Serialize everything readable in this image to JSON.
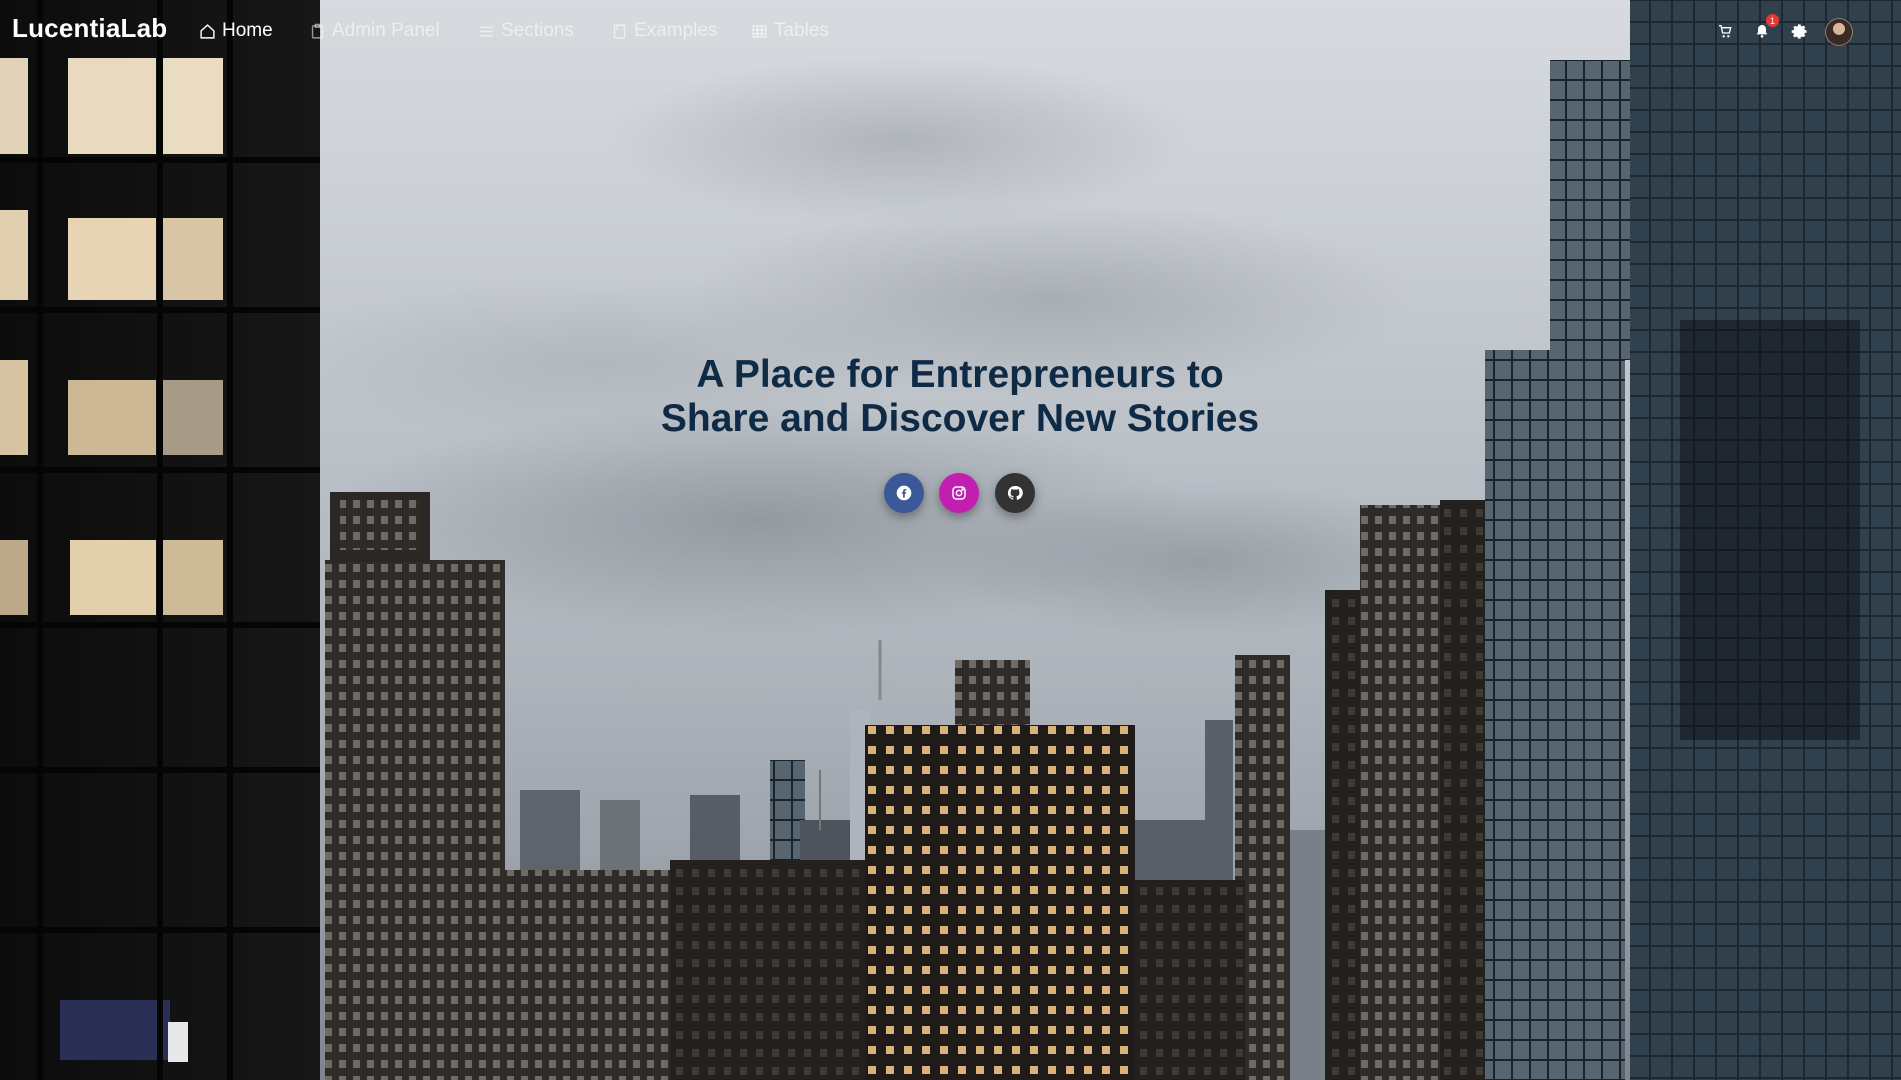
{
  "brand": {
    "name": "LucentiaLab"
  },
  "nav": {
    "items": [
      {
        "label": "Home",
        "icon": "home-icon",
        "active": true
      },
      {
        "label": "Admin Panel",
        "icon": "clipboard-icon",
        "active": false
      },
      {
        "label": "Sections",
        "icon": "list-icon",
        "active": false
      },
      {
        "label": "Examples",
        "icon": "document-icon",
        "active": false
      },
      {
        "label": "Tables",
        "icon": "table-icon",
        "active": false
      }
    ]
  },
  "topbar": {
    "cart_icon": "cart-icon",
    "notifications": {
      "icon": "bell-icon",
      "count": "1"
    },
    "settings_icon": "gear-icon",
    "avatar": "user-avatar"
  },
  "hero": {
    "title_line1": "A Place for Entrepreneurs to",
    "title_line2": "Share and Discover New Stories"
  },
  "social": [
    {
      "name": "facebook-icon",
      "color": "#3b5998"
    },
    {
      "name": "instagram-icon",
      "color": "#c21fb1"
    },
    {
      "name": "github-icon",
      "color": "#333333"
    }
  ],
  "colors": {
    "title": "#0f2a44",
    "badge": "#e53935"
  }
}
